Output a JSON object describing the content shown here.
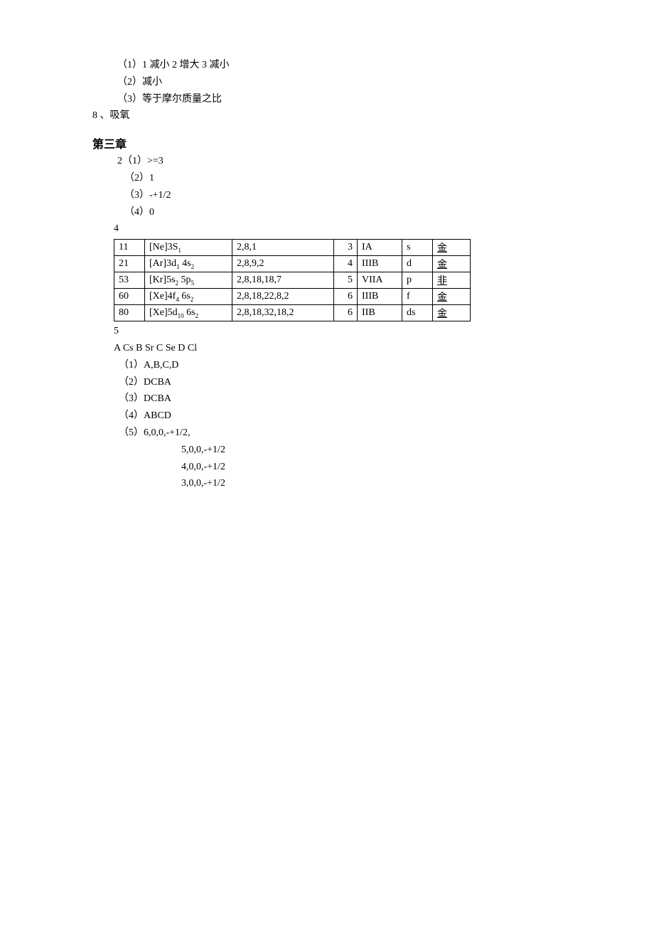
{
  "top": {
    "l1": "（1）1  减小  2 增大   3 减小",
    "l2": "（2）减小",
    "l3": "（3）等于摩尔质量之比",
    "l4": "8 、吸氧"
  },
  "heading": "第三章",
  "part2": {
    "l1": "2（1）>=3",
    "l2": "（2）1",
    "l3": "（3）-+1/2",
    "l4": "（4）0"
  },
  "label4": "4",
  "table": [
    {
      "c1": "11",
      "c2a": "[Ne]3S",
      "c2b": "1",
      "c3": "2,8,1",
      "c4": "3",
      "c5": "IA",
      "c6": "s",
      "c7": "金"
    },
    {
      "c1": "21",
      "c2a": "[Ar]3d",
      "c2b": "1",
      "c2c": " 4s",
      "c2d": "2",
      "c3": "2,8,9,2",
      "c4": "4",
      "c5": "IIIB",
      "c6": "d",
      "c7": "金"
    },
    {
      "c1": "53",
      "c2a": "[Kr]5s",
      "c2b": "2",
      "c2c": " 5p",
      "c2d": "5",
      "c3": "2,8,18,18,7",
      "c4": "5",
      "c5": "VIIA",
      "c6": "p",
      "c7": "非"
    },
    {
      "c1": "60",
      "c2a": "[Xe]4f",
      "c2b": "4",
      "c2c": " 6s",
      "c2d": "2",
      "c3": "2,8,18,22,8,2",
      "c4": "6",
      "c5": "IIIB",
      "c6": "f",
      "c7": "金"
    },
    {
      "c1": "80",
      "c2a": "[Xe]5d",
      "c2b": "10",
      "c2c": " 6s",
      "c2d": "2",
      "c3": "2,8,18,32,18,2",
      "c4": "6",
      "c5": "IIB",
      "c6": "ds",
      "c7": "金"
    }
  ],
  "label5": "5",
  "part5": {
    "header": "A Cs  B Sr   C Se  D Cl",
    "l1": "（1）A,B,C,D",
    "l2": "（2）DCBA",
    "l3": "（3）DCBA",
    "l4": "（4）ABCD",
    "l5": "（5）6,0,0,-+1/2,",
    "l6": "5,0,0,-+1/2",
    "l7": "4,0,0,-+1/2",
    "l8": "3,0,0,-+1/2"
  },
  "colwidths": {
    "c1": "30",
    "c2": "110",
    "c3": "130",
    "c4": "20",
    "c5": "50",
    "c6": "30",
    "c7": "40"
  }
}
